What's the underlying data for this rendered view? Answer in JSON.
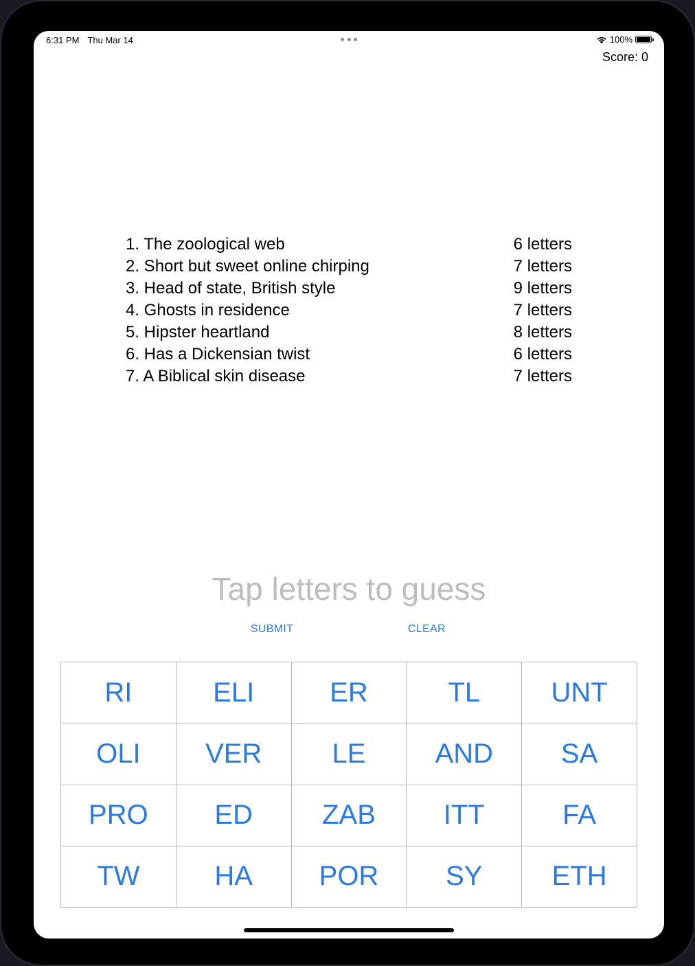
{
  "status_bar": {
    "time": "6:31 PM",
    "date": "Thu Mar 14",
    "battery": "100%",
    "icons": [
      "wifi-icon",
      "battery-icon"
    ]
  },
  "score_label": "Score: 0",
  "clues": [
    {
      "text": "1. The zoological web",
      "length": "6 letters"
    },
    {
      "text": "2. Short but sweet online chirping",
      "length": "7 letters"
    },
    {
      "text": "3. Head of state, British style",
      "length": "9 letters"
    },
    {
      "text": "4. Ghosts in residence",
      "length": "7 letters"
    },
    {
      "text": "5. Hipster heartland",
      "length": "8 letters"
    },
    {
      "text": "6. Has a Dickensian twist",
      "length": "6 letters"
    },
    {
      "text": "7. A Biblical skin disease",
      "length": "7 letters"
    }
  ],
  "guess_placeholder": "Tap letters to guess",
  "actions": {
    "submit_label": "SUBMIT",
    "clear_label": "CLEAR"
  },
  "tiles": [
    "RI",
    "ELI",
    "ER",
    "TL",
    "UNT",
    "OLI",
    "VER",
    "LE",
    "AND",
    "SA",
    "PRO",
    "ED",
    "ZAB",
    "ITT",
    "FA",
    "TW",
    "HA",
    "POR",
    "SY",
    "ETH"
  ],
  "colors": {
    "accent": "#2a7ae2",
    "placeholder": "#bdbdbd",
    "grid_border": "#b6b6b6"
  }
}
